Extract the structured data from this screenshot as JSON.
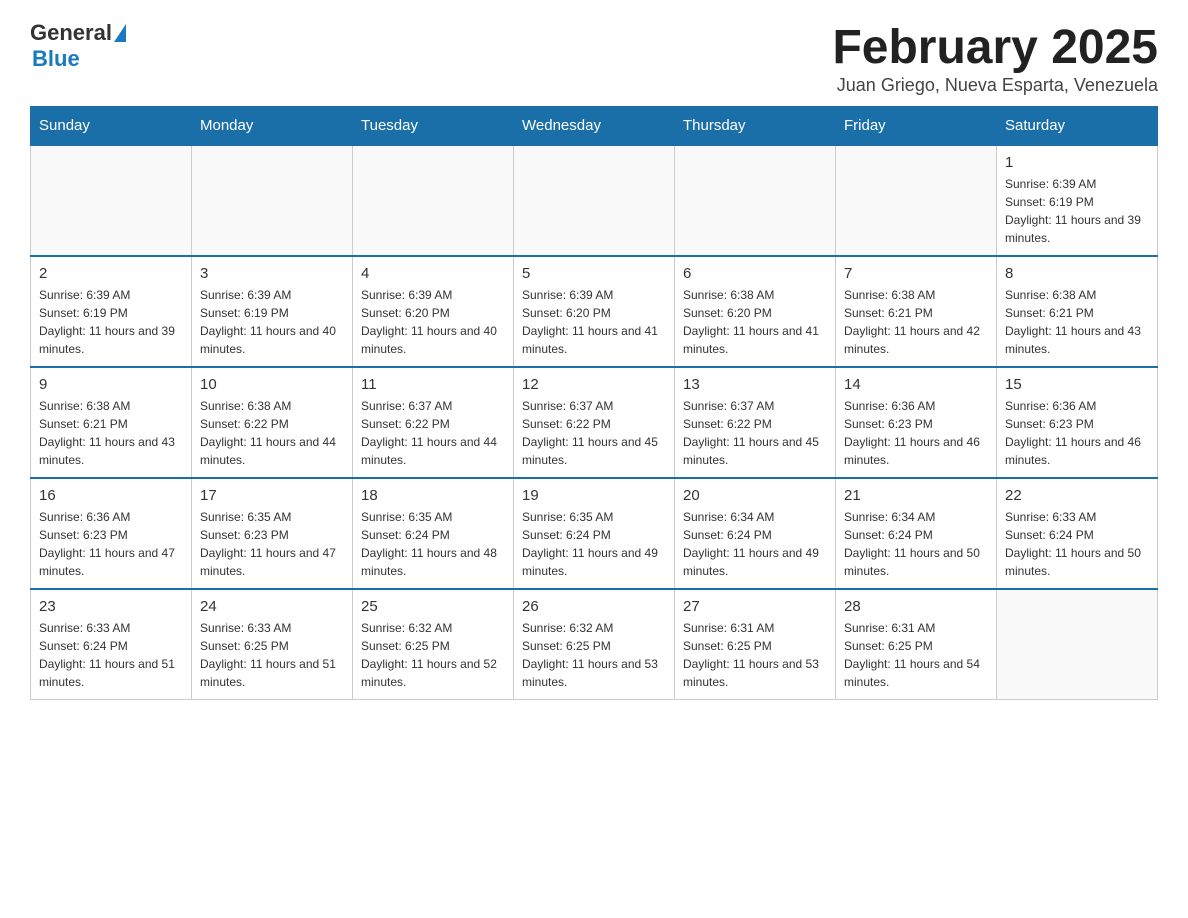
{
  "header": {
    "logo": {
      "text_general": "General",
      "text_blue": "Blue"
    },
    "title": "February 2025",
    "subtitle": "Juan Griego, Nueva Esparta, Venezuela"
  },
  "days_of_week": [
    "Sunday",
    "Monday",
    "Tuesday",
    "Wednesday",
    "Thursday",
    "Friday",
    "Saturday"
  ],
  "weeks": [
    {
      "days": [
        {
          "number": "",
          "info": ""
        },
        {
          "number": "",
          "info": ""
        },
        {
          "number": "",
          "info": ""
        },
        {
          "number": "",
          "info": ""
        },
        {
          "number": "",
          "info": ""
        },
        {
          "number": "",
          "info": ""
        },
        {
          "number": "1",
          "info": "Sunrise: 6:39 AM\nSunset: 6:19 PM\nDaylight: 11 hours and 39 minutes."
        }
      ]
    },
    {
      "days": [
        {
          "number": "2",
          "info": "Sunrise: 6:39 AM\nSunset: 6:19 PM\nDaylight: 11 hours and 39 minutes."
        },
        {
          "number": "3",
          "info": "Sunrise: 6:39 AM\nSunset: 6:19 PM\nDaylight: 11 hours and 40 minutes."
        },
        {
          "number": "4",
          "info": "Sunrise: 6:39 AM\nSunset: 6:20 PM\nDaylight: 11 hours and 40 minutes."
        },
        {
          "number": "5",
          "info": "Sunrise: 6:39 AM\nSunset: 6:20 PM\nDaylight: 11 hours and 41 minutes."
        },
        {
          "number": "6",
          "info": "Sunrise: 6:38 AM\nSunset: 6:20 PM\nDaylight: 11 hours and 41 minutes."
        },
        {
          "number": "7",
          "info": "Sunrise: 6:38 AM\nSunset: 6:21 PM\nDaylight: 11 hours and 42 minutes."
        },
        {
          "number": "8",
          "info": "Sunrise: 6:38 AM\nSunset: 6:21 PM\nDaylight: 11 hours and 43 minutes."
        }
      ]
    },
    {
      "days": [
        {
          "number": "9",
          "info": "Sunrise: 6:38 AM\nSunset: 6:21 PM\nDaylight: 11 hours and 43 minutes."
        },
        {
          "number": "10",
          "info": "Sunrise: 6:38 AM\nSunset: 6:22 PM\nDaylight: 11 hours and 44 minutes."
        },
        {
          "number": "11",
          "info": "Sunrise: 6:37 AM\nSunset: 6:22 PM\nDaylight: 11 hours and 44 minutes."
        },
        {
          "number": "12",
          "info": "Sunrise: 6:37 AM\nSunset: 6:22 PM\nDaylight: 11 hours and 45 minutes."
        },
        {
          "number": "13",
          "info": "Sunrise: 6:37 AM\nSunset: 6:22 PM\nDaylight: 11 hours and 45 minutes."
        },
        {
          "number": "14",
          "info": "Sunrise: 6:36 AM\nSunset: 6:23 PM\nDaylight: 11 hours and 46 minutes."
        },
        {
          "number": "15",
          "info": "Sunrise: 6:36 AM\nSunset: 6:23 PM\nDaylight: 11 hours and 46 minutes."
        }
      ]
    },
    {
      "days": [
        {
          "number": "16",
          "info": "Sunrise: 6:36 AM\nSunset: 6:23 PM\nDaylight: 11 hours and 47 minutes."
        },
        {
          "number": "17",
          "info": "Sunrise: 6:35 AM\nSunset: 6:23 PM\nDaylight: 11 hours and 47 minutes."
        },
        {
          "number": "18",
          "info": "Sunrise: 6:35 AM\nSunset: 6:24 PM\nDaylight: 11 hours and 48 minutes."
        },
        {
          "number": "19",
          "info": "Sunrise: 6:35 AM\nSunset: 6:24 PM\nDaylight: 11 hours and 49 minutes."
        },
        {
          "number": "20",
          "info": "Sunrise: 6:34 AM\nSunset: 6:24 PM\nDaylight: 11 hours and 49 minutes."
        },
        {
          "number": "21",
          "info": "Sunrise: 6:34 AM\nSunset: 6:24 PM\nDaylight: 11 hours and 50 minutes."
        },
        {
          "number": "22",
          "info": "Sunrise: 6:33 AM\nSunset: 6:24 PM\nDaylight: 11 hours and 50 minutes."
        }
      ]
    },
    {
      "days": [
        {
          "number": "23",
          "info": "Sunrise: 6:33 AM\nSunset: 6:24 PM\nDaylight: 11 hours and 51 minutes."
        },
        {
          "number": "24",
          "info": "Sunrise: 6:33 AM\nSunset: 6:25 PM\nDaylight: 11 hours and 51 minutes."
        },
        {
          "number": "25",
          "info": "Sunrise: 6:32 AM\nSunset: 6:25 PM\nDaylight: 11 hours and 52 minutes."
        },
        {
          "number": "26",
          "info": "Sunrise: 6:32 AM\nSunset: 6:25 PM\nDaylight: 11 hours and 53 minutes."
        },
        {
          "number": "27",
          "info": "Sunrise: 6:31 AM\nSunset: 6:25 PM\nDaylight: 11 hours and 53 minutes."
        },
        {
          "number": "28",
          "info": "Sunrise: 6:31 AM\nSunset: 6:25 PM\nDaylight: 11 hours and 54 minutes."
        },
        {
          "number": "",
          "info": ""
        }
      ]
    }
  ]
}
